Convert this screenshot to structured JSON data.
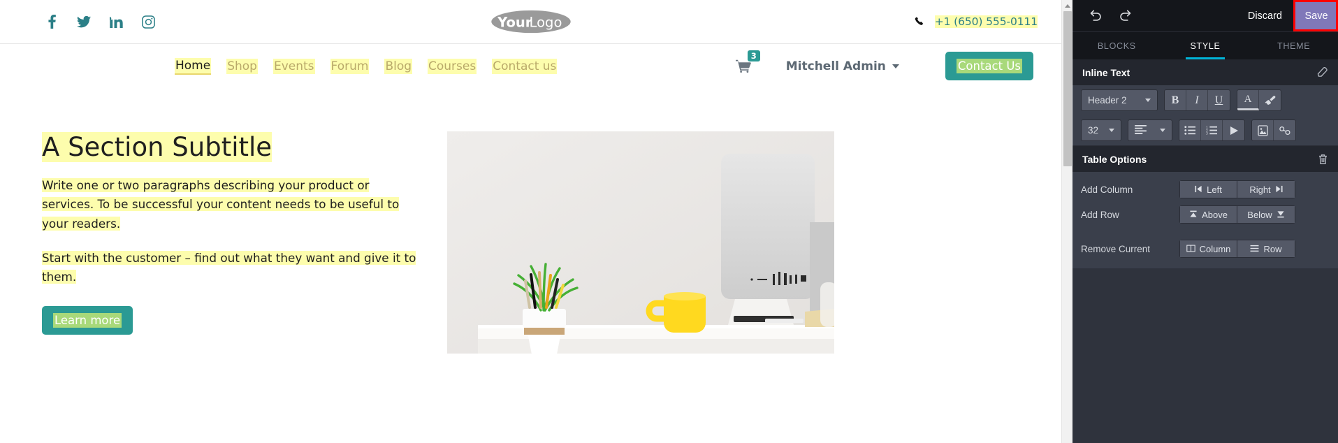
{
  "website": {
    "topbar": {
      "social": [
        {
          "name": "facebook-icon",
          "label": "f"
        },
        {
          "name": "twitter-icon",
          "label": "t"
        },
        {
          "name": "linkedin-icon",
          "label": "in"
        },
        {
          "name": "instagram-icon",
          "label": "ig"
        }
      ],
      "logo_text": "YourLogo",
      "phone": "+1 (650) 555-0111"
    },
    "nav": {
      "links": [
        {
          "label": "Home",
          "active": true
        },
        {
          "label": "Shop",
          "active": false
        },
        {
          "label": "Events",
          "active": false
        },
        {
          "label": "Forum",
          "active": false
        },
        {
          "label": "Blog",
          "active": false
        },
        {
          "label": "Courses",
          "active": false
        },
        {
          "label": "Contact us",
          "active": false
        }
      ],
      "cart_count": "3",
      "user": "Mitchell Admin",
      "cta": "Contact Us"
    },
    "hero": {
      "title": "A Section Subtitle",
      "paragraph1": "Write one or two paragraphs describing your product or services. To be successful your content needs to be useful to your readers.",
      "paragraph2": "Start with the customer – find out what they want and give it to them.",
      "button": "Learn more",
      "image_alt": "desk-with-plant-mug-and-monitor"
    }
  },
  "editor": {
    "topbar": {
      "undo": "↶",
      "redo": "↷",
      "discard": "Discard",
      "save": "Save"
    },
    "tabs": [
      {
        "label": "BLOCKS",
        "active": false
      },
      {
        "label": "STYLE",
        "active": true
      },
      {
        "label": "THEME",
        "active": false
      }
    ],
    "inline_text": {
      "title": "Inline Text",
      "clear_format_icon": "eraser-icon",
      "style_select": "Header 2",
      "bold": "B",
      "italic": "I",
      "underline": "U",
      "font_color": "A",
      "background_color": "brush-icon",
      "font_size": "32",
      "align_icon": "align-left-icon",
      "unordered_list": "bullet-list-icon",
      "ordered_list": "numbered-list-icon",
      "media_play": "play-icon",
      "image": "image-icon",
      "link": "link-icon"
    },
    "table_options": {
      "title": "Table Options",
      "delete_icon": "trash-icon",
      "rows": [
        {
          "label": "Add Column",
          "buttons": [
            {
              "text": "Left",
              "icon": "arrow-to-left-icon",
              "icon_side": "left"
            },
            {
              "text": "Right",
              "icon": "arrow-to-right-icon",
              "icon_side": "right"
            }
          ]
        },
        {
          "label": "Add Row",
          "buttons": [
            {
              "text": "Above",
              "icon": "arrow-to-top-icon",
              "icon_side": "left"
            },
            {
              "text": "Below",
              "icon": "arrow-to-bottom-icon",
              "icon_side": "right"
            }
          ]
        },
        {
          "label": "Remove Current",
          "buttons": [
            {
              "text": "Column",
              "icon": "columns-icon",
              "icon_side": "left"
            },
            {
              "text": "Row",
              "icon": "rows-icon",
              "icon_side": "left"
            }
          ]
        }
      ]
    },
    "colors": {
      "accent": "#00b4d8",
      "save_button": "#8078b9",
      "highlight_border": "#ff0000",
      "panel_bg": "#3a3f4b",
      "panel_dark": "#14161b"
    }
  }
}
